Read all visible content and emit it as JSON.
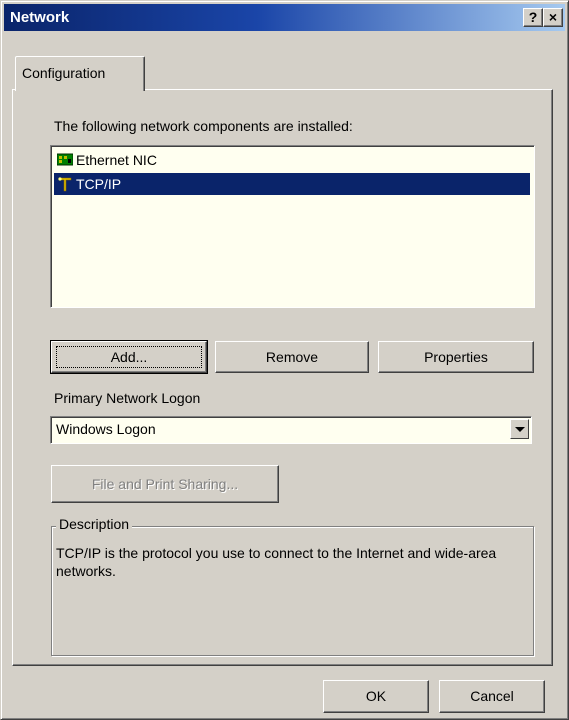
{
  "window": {
    "title": "Network",
    "help_glyph": "?",
    "close_glyph": "×"
  },
  "tabs": [
    {
      "label": "Configuration",
      "active": true
    }
  ],
  "components": {
    "label": "The following network components are installed:",
    "items": [
      {
        "label": "Ethernet NIC",
        "icon": "network-adapter-icon",
        "selected": false
      },
      {
        "label": "TCP/IP",
        "icon": "protocol-icon",
        "selected": true
      }
    ]
  },
  "buttons": {
    "add": "Add...",
    "remove": "Remove",
    "properties": "Properties",
    "sharing": "File and Print Sharing...",
    "ok": "OK",
    "cancel": "Cancel"
  },
  "logon": {
    "label": "Primary Network Logon",
    "value": "Windows Logon"
  },
  "description": {
    "title": "Description",
    "text": "TCP/IP is the protocol you use to connect to the Internet and wide-area networks."
  },
  "colors": {
    "face": "#d4d0c8",
    "title_start": "#0a246a",
    "title_end": "#a6caf0",
    "selection": "#0a246a",
    "list_bg": "#fffff0"
  }
}
